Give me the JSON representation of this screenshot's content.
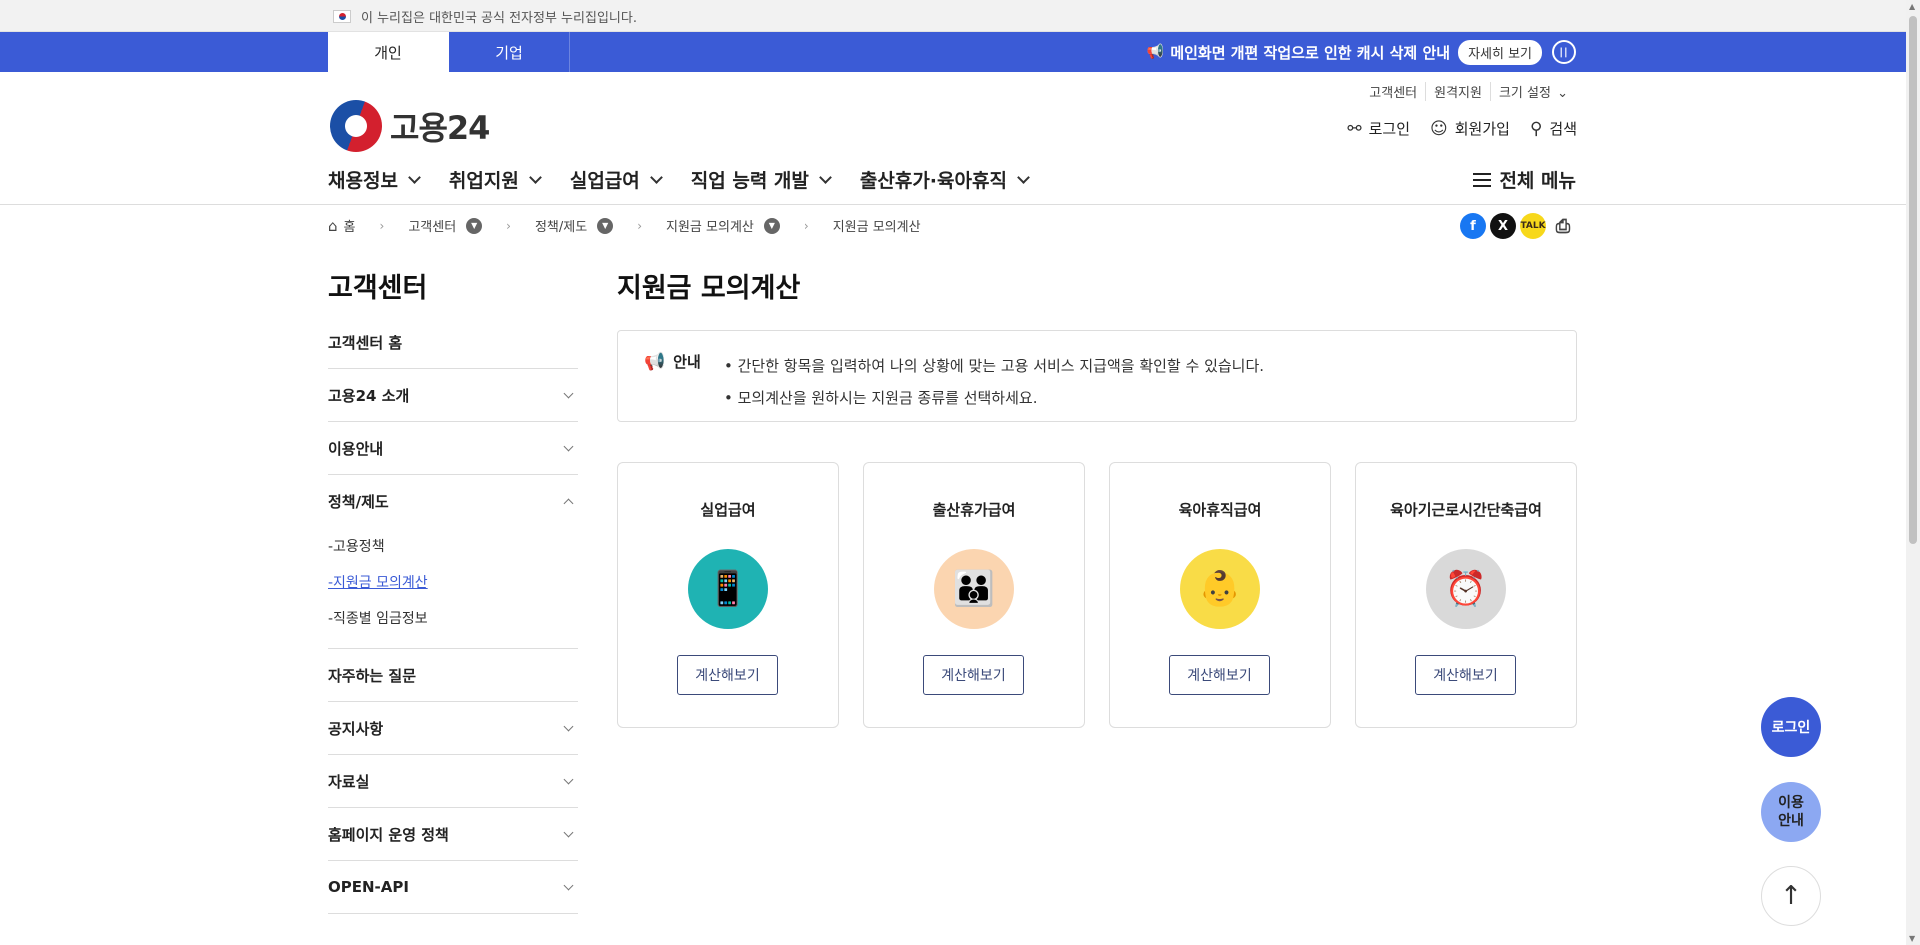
{
  "gov_banner": {
    "text": "이 누리집은 대한민국 공식 전자정부 누리집입니다."
  },
  "type_tabs": [
    {
      "label": "개인",
      "active": true
    },
    {
      "label": "기업",
      "active": false
    }
  ],
  "notice": {
    "icon": "megaphone-icon",
    "text": "메인화면 개편 작업으로 인한 캐시 삭제 안내",
    "detail_label": "자세히 보기"
  },
  "util_links": [
    "고객센터",
    "원격지원",
    "크기 설정"
  ],
  "logo": {
    "text": "고용24"
  },
  "header_actions": {
    "login": "로그인",
    "signup": "회원가입",
    "search": "검색"
  },
  "main_nav": [
    "채용정보",
    "취업지원",
    "실업급여",
    "직업 능력 개발",
    "출산휴가·육아휴직"
  ],
  "all_menu": "전체 메뉴",
  "breadcrumb": [
    "홈",
    "고객센터",
    "정책/제도",
    "지원금 모의계산",
    "지원금 모의계산"
  ],
  "sidebar": {
    "title": "고객센터",
    "items": [
      {
        "label": "고객센터 홈"
      },
      {
        "label": "고용24 소개"
      },
      {
        "label": "이용안내"
      },
      {
        "label": "정책/제도",
        "subitems": [
          "-고용정책",
          "-지원금 모의계산",
          "-직종별 임금정보"
        ]
      },
      {
        "label": "자주하는 질문"
      },
      {
        "label": "공지사항"
      },
      {
        "label": "자료실"
      },
      {
        "label": "홈페이지 운영 정책"
      },
      {
        "label": "OPEN-API"
      }
    ]
  },
  "main": {
    "title": "지원금 모의계산",
    "info_label": "안내",
    "info_lines": [
      "• 간단한 항목을 입력하여 나의 상황에 맞는 고용 서비스 지급액을 확인할 수 있습니다.",
      "• 모의계산을 원하시는 지원금 종류를 선택하세요."
    ],
    "cards": [
      {
        "title": "실업급여",
        "button": "계산해보기"
      },
      {
        "title": "출산휴가급여",
        "button": "계산해보기"
      },
      {
        "title": "육아휴직급여",
        "button": "계산해보기"
      },
      {
        "title": "육아기근로시간단축급여",
        "button": "계산해보기"
      }
    ]
  },
  "floating": {
    "login": "로그인",
    "guide": "이용\n안내"
  },
  "colors": {
    "brand_blue": "#3b5bd6",
    "light_blue": "#8ca8f2"
  }
}
